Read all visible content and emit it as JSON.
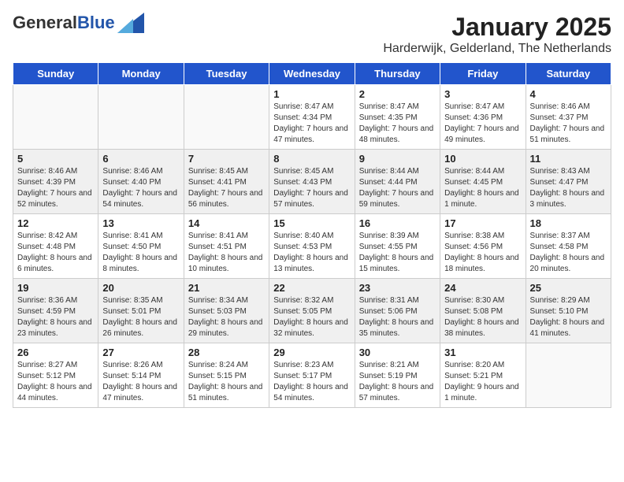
{
  "header": {
    "logo_general": "General",
    "logo_blue": "Blue",
    "month_title": "January 2025",
    "subtitle": "Harderwijk, Gelderland, The Netherlands"
  },
  "weekdays": [
    "Sunday",
    "Monday",
    "Tuesday",
    "Wednesday",
    "Thursday",
    "Friday",
    "Saturday"
  ],
  "weeks": [
    [
      {
        "day": "",
        "info": ""
      },
      {
        "day": "",
        "info": ""
      },
      {
        "day": "",
        "info": ""
      },
      {
        "day": "1",
        "info": "Sunrise: 8:47 AM\nSunset: 4:34 PM\nDaylight: 7 hours and 47 minutes."
      },
      {
        "day": "2",
        "info": "Sunrise: 8:47 AM\nSunset: 4:35 PM\nDaylight: 7 hours and 48 minutes."
      },
      {
        "day": "3",
        "info": "Sunrise: 8:47 AM\nSunset: 4:36 PM\nDaylight: 7 hours and 49 minutes."
      },
      {
        "day": "4",
        "info": "Sunrise: 8:46 AM\nSunset: 4:37 PM\nDaylight: 7 hours and 51 minutes."
      }
    ],
    [
      {
        "day": "5",
        "info": "Sunrise: 8:46 AM\nSunset: 4:39 PM\nDaylight: 7 hours and 52 minutes."
      },
      {
        "day": "6",
        "info": "Sunrise: 8:46 AM\nSunset: 4:40 PM\nDaylight: 7 hours and 54 minutes."
      },
      {
        "day": "7",
        "info": "Sunrise: 8:45 AM\nSunset: 4:41 PM\nDaylight: 7 hours and 56 minutes."
      },
      {
        "day": "8",
        "info": "Sunrise: 8:45 AM\nSunset: 4:43 PM\nDaylight: 7 hours and 57 minutes."
      },
      {
        "day": "9",
        "info": "Sunrise: 8:44 AM\nSunset: 4:44 PM\nDaylight: 7 hours and 59 minutes."
      },
      {
        "day": "10",
        "info": "Sunrise: 8:44 AM\nSunset: 4:45 PM\nDaylight: 8 hours and 1 minute."
      },
      {
        "day": "11",
        "info": "Sunrise: 8:43 AM\nSunset: 4:47 PM\nDaylight: 8 hours and 3 minutes."
      }
    ],
    [
      {
        "day": "12",
        "info": "Sunrise: 8:42 AM\nSunset: 4:48 PM\nDaylight: 8 hours and 6 minutes."
      },
      {
        "day": "13",
        "info": "Sunrise: 8:41 AM\nSunset: 4:50 PM\nDaylight: 8 hours and 8 minutes."
      },
      {
        "day": "14",
        "info": "Sunrise: 8:41 AM\nSunset: 4:51 PM\nDaylight: 8 hours and 10 minutes."
      },
      {
        "day": "15",
        "info": "Sunrise: 8:40 AM\nSunset: 4:53 PM\nDaylight: 8 hours and 13 minutes."
      },
      {
        "day": "16",
        "info": "Sunrise: 8:39 AM\nSunset: 4:55 PM\nDaylight: 8 hours and 15 minutes."
      },
      {
        "day": "17",
        "info": "Sunrise: 8:38 AM\nSunset: 4:56 PM\nDaylight: 8 hours and 18 minutes."
      },
      {
        "day": "18",
        "info": "Sunrise: 8:37 AM\nSunset: 4:58 PM\nDaylight: 8 hours and 20 minutes."
      }
    ],
    [
      {
        "day": "19",
        "info": "Sunrise: 8:36 AM\nSunset: 4:59 PM\nDaylight: 8 hours and 23 minutes."
      },
      {
        "day": "20",
        "info": "Sunrise: 8:35 AM\nSunset: 5:01 PM\nDaylight: 8 hours and 26 minutes."
      },
      {
        "day": "21",
        "info": "Sunrise: 8:34 AM\nSunset: 5:03 PM\nDaylight: 8 hours and 29 minutes."
      },
      {
        "day": "22",
        "info": "Sunrise: 8:32 AM\nSunset: 5:05 PM\nDaylight: 8 hours and 32 minutes."
      },
      {
        "day": "23",
        "info": "Sunrise: 8:31 AM\nSunset: 5:06 PM\nDaylight: 8 hours and 35 minutes."
      },
      {
        "day": "24",
        "info": "Sunrise: 8:30 AM\nSunset: 5:08 PM\nDaylight: 8 hours and 38 minutes."
      },
      {
        "day": "25",
        "info": "Sunrise: 8:29 AM\nSunset: 5:10 PM\nDaylight: 8 hours and 41 minutes."
      }
    ],
    [
      {
        "day": "26",
        "info": "Sunrise: 8:27 AM\nSunset: 5:12 PM\nDaylight: 8 hours and 44 minutes."
      },
      {
        "day": "27",
        "info": "Sunrise: 8:26 AM\nSunset: 5:14 PM\nDaylight: 8 hours and 47 minutes."
      },
      {
        "day": "28",
        "info": "Sunrise: 8:24 AM\nSunset: 5:15 PM\nDaylight: 8 hours and 51 minutes."
      },
      {
        "day": "29",
        "info": "Sunrise: 8:23 AM\nSunset: 5:17 PM\nDaylight: 8 hours and 54 minutes."
      },
      {
        "day": "30",
        "info": "Sunrise: 8:21 AM\nSunset: 5:19 PM\nDaylight: 8 hours and 57 minutes."
      },
      {
        "day": "31",
        "info": "Sunrise: 8:20 AM\nSunset: 5:21 PM\nDaylight: 9 hours and 1 minute."
      },
      {
        "day": "",
        "info": ""
      }
    ]
  ]
}
